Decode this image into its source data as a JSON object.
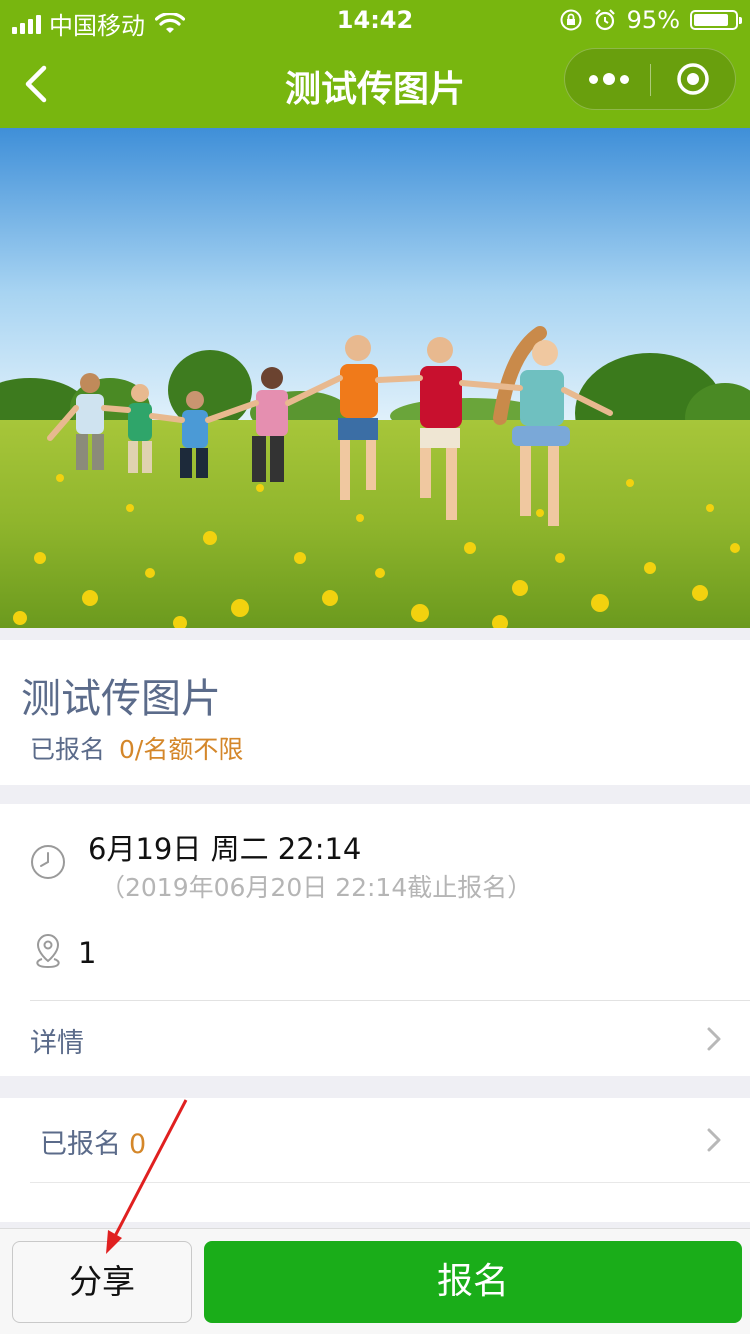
{
  "status_bar": {
    "carrier": "中国移动",
    "time": "14:42",
    "battery": "95%",
    "battery_level": 0.95
  },
  "nav": {
    "title": "测试传图片",
    "back_icon": "chevron-left-icon",
    "more_icon": "more-dots-icon",
    "close_icon": "target-close-icon",
    "bar_color": "#78b60f"
  },
  "event": {
    "title": "测试传图片",
    "signed_label": "已报名",
    "quota": "0/名额不限",
    "datetime": "6月19日 周二 22:14",
    "deadline": "（2019年06月20日 22:14截止报名）",
    "location": "1",
    "detail_label": "详情"
  },
  "registered": {
    "label": "已报名",
    "count": "0"
  },
  "actions": {
    "share_label": "分享",
    "signup_label": "报名",
    "signup_color": "#1aad19"
  },
  "accent_color": "#d4872a",
  "annotation_color": "#e02020"
}
